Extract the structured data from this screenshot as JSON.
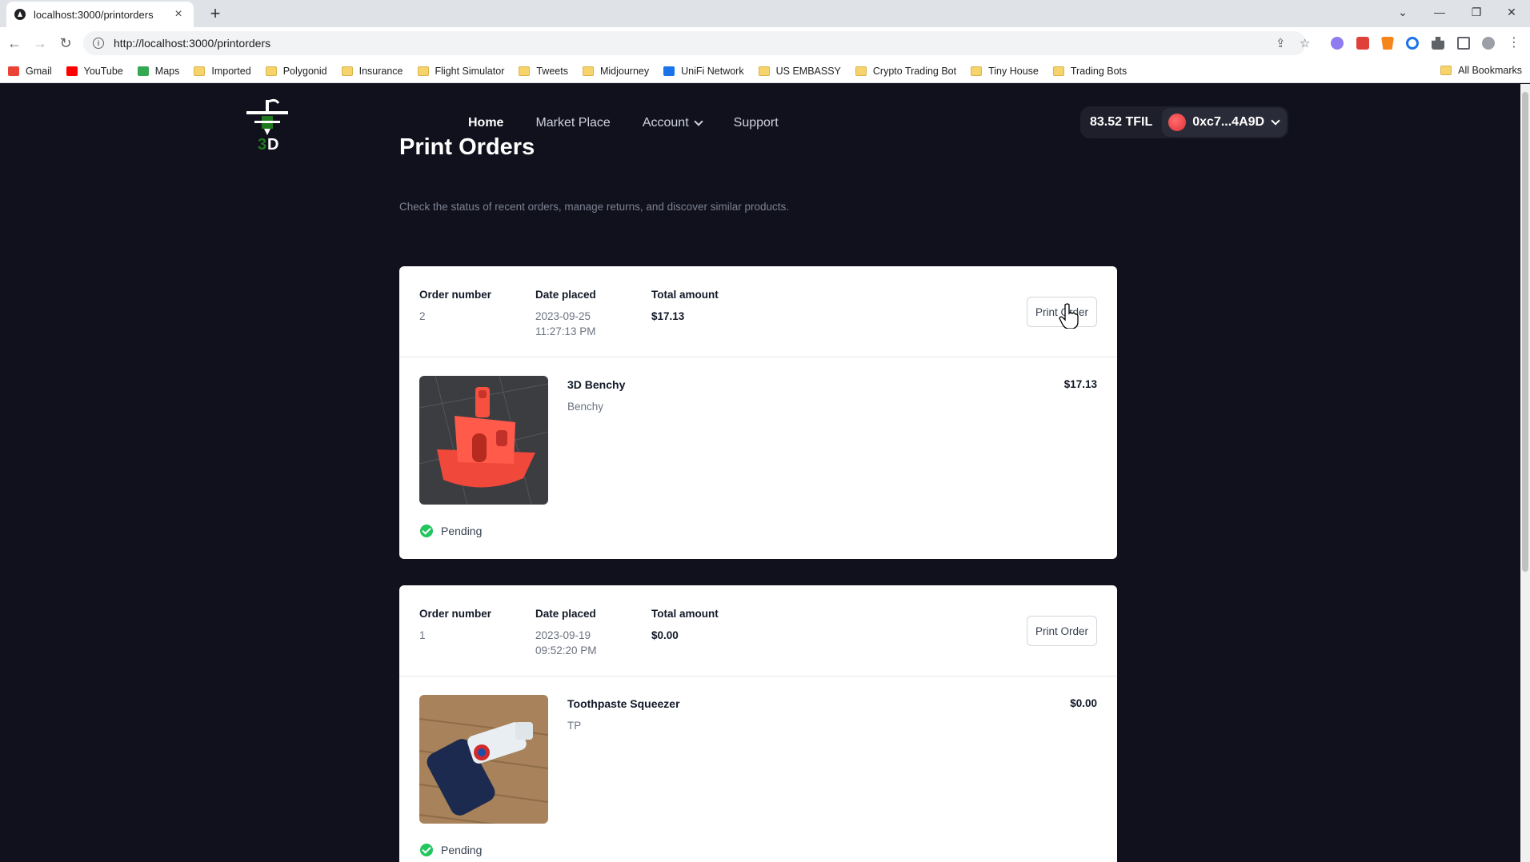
{
  "browser": {
    "tab_title": "localhost:3000/printorders",
    "tab_close": "×",
    "new_tab": "+",
    "url_host": "http://localhost:3000",
    "url_path": "/printorders",
    "bookmarks": [
      {
        "label": "Gmail",
        "icon": "gmail-icon",
        "color": "#ea4335"
      },
      {
        "label": "YouTube",
        "icon": "youtube-icon",
        "color": "#ff0000"
      },
      {
        "label": "Maps",
        "icon": "maps-icon",
        "color": "#34a853"
      },
      {
        "label": "Imported",
        "icon": "folder-icon"
      },
      {
        "label": "Polygonid",
        "icon": "folder-icon"
      },
      {
        "label": "Insurance",
        "icon": "folder-icon"
      },
      {
        "label": "Flight Simulator",
        "icon": "folder-icon"
      },
      {
        "label": "Tweets",
        "icon": "folder-icon"
      },
      {
        "label": "Midjourney",
        "icon": "folder-icon"
      },
      {
        "label": "UniFi Network",
        "icon": "unifi-icon",
        "color": "#1a73e8"
      },
      {
        "label": "US EMBASSY",
        "icon": "folder-icon"
      },
      {
        "label": "Crypto Trading Bot",
        "icon": "folder-icon"
      },
      {
        "label": "Tiny House",
        "icon": "folder-icon"
      },
      {
        "label": "Trading Bots",
        "icon": "folder-icon"
      }
    ],
    "all_bookmarks": "All Bookmarks"
  },
  "header": {
    "nav": [
      {
        "label": "Home",
        "active": true
      },
      {
        "label": "Market Place",
        "active": false
      },
      {
        "label": "Account",
        "active": false,
        "dropdown": true
      },
      {
        "label": "Support",
        "active": false
      }
    ],
    "balance": "83.52 TFIL",
    "account": "0xc7...4A9D"
  },
  "main": {
    "title": "Print Orders",
    "subtitle": "Check the status of recent orders, manage returns, and discover similar products."
  },
  "labels": {
    "order_number": "Order number",
    "date_placed": "Date placed",
    "total_amount": "Total amount",
    "print_order": "Print Order"
  },
  "orders": [
    {
      "number": "2",
      "date": "2023-09-25",
      "time": "11:27:13 PM",
      "total": "$17.13",
      "item": {
        "name": "3D Benchy",
        "description": "Benchy",
        "price": "$17.13",
        "image": "red-benchy-boat"
      },
      "status": "Pending"
    },
    {
      "number": "1",
      "date": "2023-09-19",
      "time": "09:52:20 PM",
      "total": "$0.00",
      "item": {
        "name": "Toothpaste Squeezer",
        "description": "TP",
        "price": "$0.00",
        "image": "toothpaste-squeezer"
      },
      "status": "Pending"
    }
  ],
  "colors": {
    "page_bg": "#10111c",
    "card_bg": "#ffffff",
    "status_green": "#22c55e",
    "logo_green": "#1f7a1f"
  }
}
